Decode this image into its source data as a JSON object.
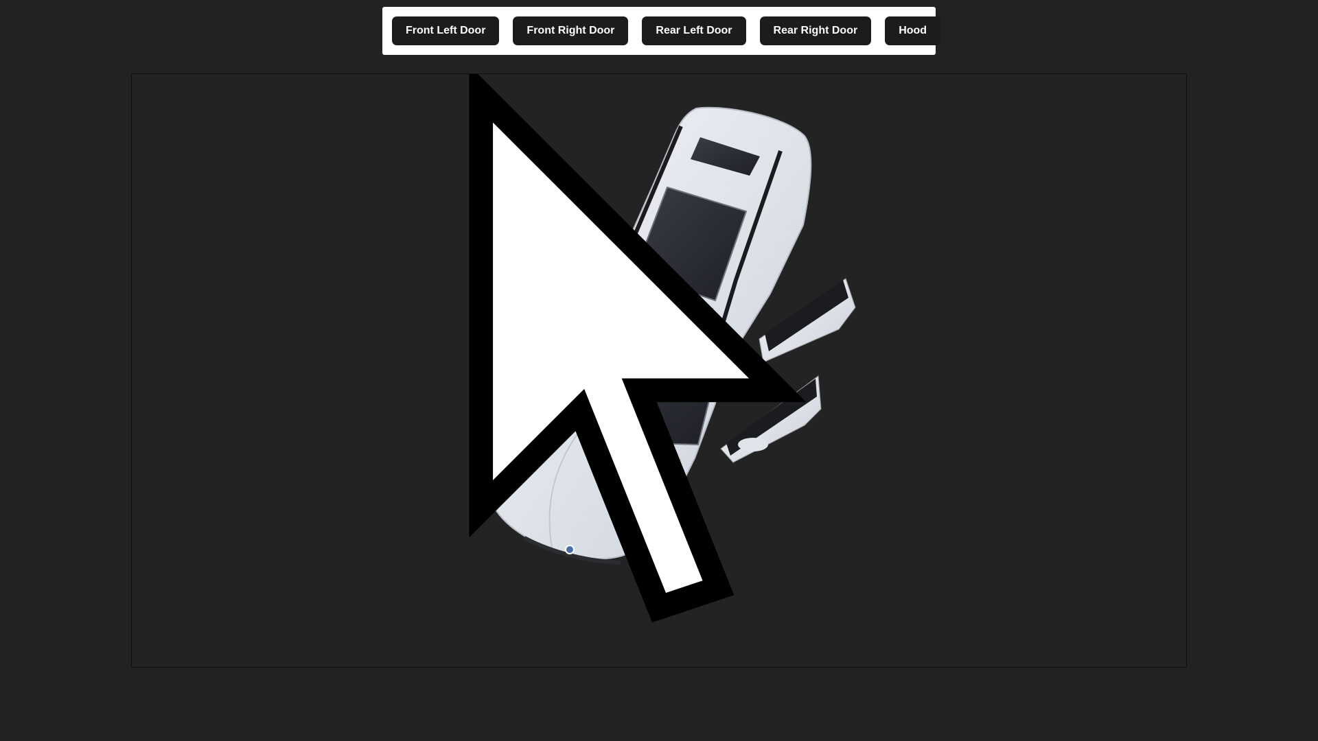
{
  "toolbar": {
    "buttons": [
      {
        "label": "Front Left Door"
      },
      {
        "label": "Front Right Door"
      },
      {
        "label": "Rear Left Door"
      },
      {
        "label": "Rear Right Door"
      },
      {
        "label": "Hood"
      }
    ]
  },
  "viewer": {
    "model": "car-top-view",
    "icons": [
      "mouse-cursor-icon"
    ]
  },
  "colors": {
    "page_background": "#222222",
    "toolbar_background": "#ffffff",
    "button_background": "#1c1c1c",
    "button_text": "#ffffff",
    "car_body": "#e4e7ee",
    "glass": "#2a2c33"
  }
}
